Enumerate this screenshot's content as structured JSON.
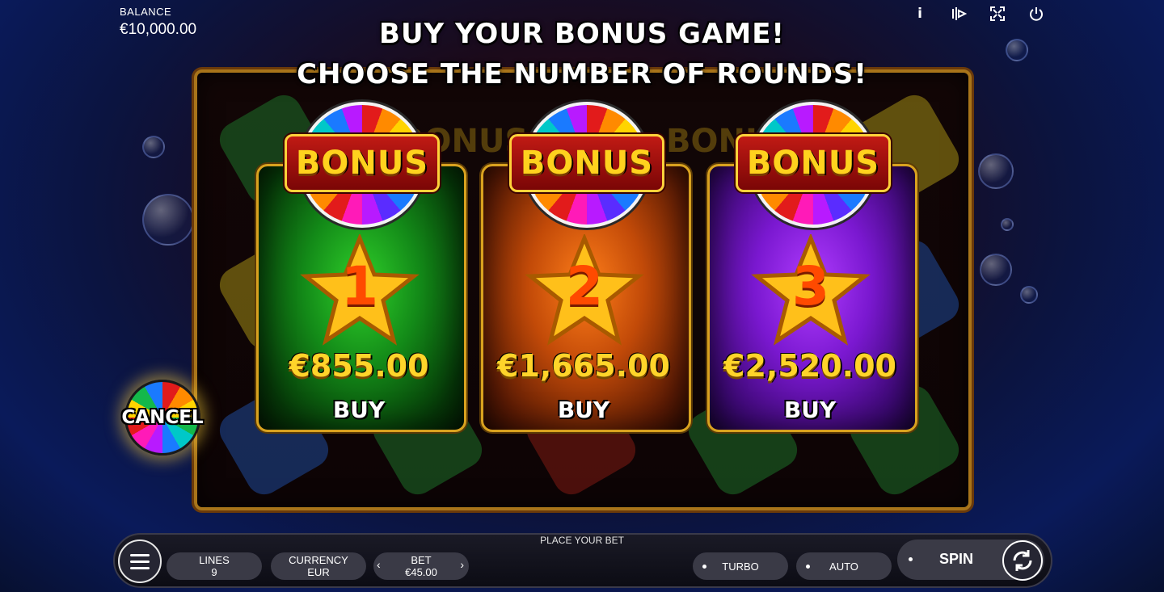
{
  "header": {
    "balance_label": "BALANCE",
    "balance_value": "€10,000.00",
    "icons": [
      "info-icon",
      "sound-icon",
      "fullscreen-icon",
      "power-icon"
    ]
  },
  "headline": {
    "line1": "BUY YOUR BONUS GAME!",
    "line2": "CHOOSE THE NUMBER OF ROUNDS!"
  },
  "cards": [
    {
      "badge": "BONUS",
      "rounds": "1",
      "price": "€855.00",
      "action": "BUY",
      "color": "#1a9a1a"
    },
    {
      "badge": "BONUS",
      "rounds": "2",
      "price": "€1,665.00",
      "action": "BUY",
      "color": "#e0620e"
    },
    {
      "badge": "BONUS",
      "rounds": "3",
      "price": "€2,520.00",
      "action": "BUY",
      "color": "#8a1ae0"
    }
  ],
  "cancel": {
    "label": "CANCEL"
  },
  "bottom_bar": {
    "status": "PLACE YOUR BET",
    "lines_label": "LINES",
    "lines_value": "9",
    "currency_label": "CURRENCY",
    "currency_value": "EUR",
    "bet_label": "BET",
    "bet_value": "€45.00",
    "turbo_label": "TURBO",
    "auto_label": "AUTO",
    "spin_label": "SPIN"
  },
  "colors": {
    "accent_gold": "#d9a21f",
    "frame": "#a8741a"
  }
}
